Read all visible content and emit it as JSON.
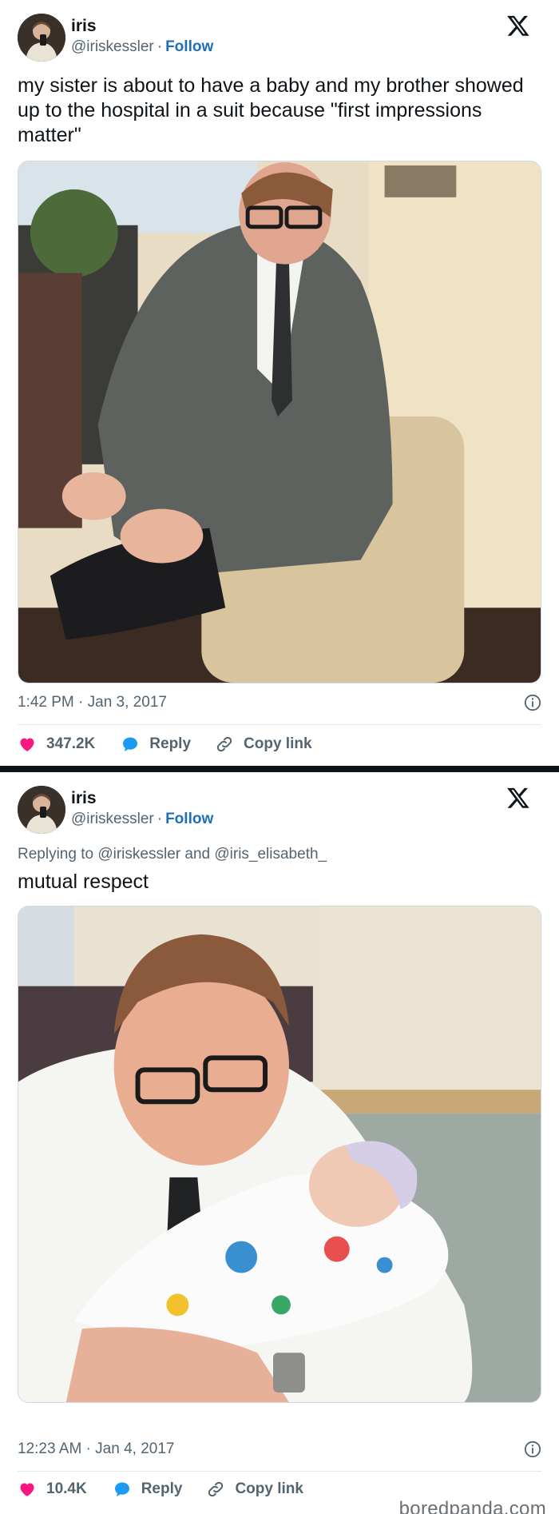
{
  "tweets": [
    {
      "author": {
        "name": "iris",
        "handle": "@iriskessler",
        "separator": "·",
        "follow_label": "Follow"
      },
      "text": "my sister is about to have a baby and my brother showed up to the hospital in a suit because \"first impressions matter\"",
      "timestamp": "1:42 PM · Jan 3, 2017",
      "likes": "347.2K",
      "reply_label": "Reply",
      "copy_link_label": "Copy link"
    },
    {
      "author": {
        "name": "iris",
        "handle": "@iriskessler",
        "separator": "·",
        "follow_label": "Follow"
      },
      "replying_prefix": "Replying to",
      "replying_handle_1": "@iriskessler",
      "replying_and": "and",
      "replying_handle_2": "@iris_elisabeth_",
      "text": "mutual respect",
      "timestamp": "12:23 AM · Jan 4, 2017",
      "likes": "10.4K",
      "reply_label": "Reply",
      "copy_link_label": "Copy link"
    }
  ],
  "watermark": "boredpanda.com",
  "colors": {
    "like": "#f91880",
    "reply": "#1d9bf0",
    "follow": "#1d6fb8",
    "muted": "#536471"
  },
  "icons": [
    "x-logo-icon",
    "info-icon",
    "heart-icon",
    "speech-bubble-icon",
    "link-icon"
  ]
}
